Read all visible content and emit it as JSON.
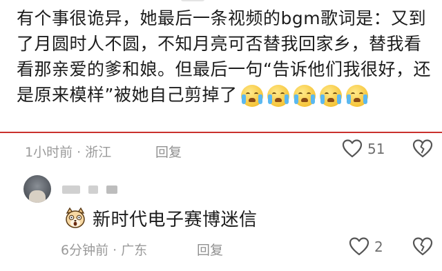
{
  "comment": {
    "text": "有个事很诡异，她最后一条视频的bgm歌词是：又到了月圆时人不圆，不知月亮可否替我回家乡，替我看看那亲爱的爹和娘。但最后一句“告诉他们我很好，还是原来模样”被她自己剪掉了",
    "emoji_count": 5,
    "emoji_name": "crying-emoji",
    "time": "1小时前 · 浙江",
    "reply_label": "回复",
    "likes": "51"
  },
  "reply": {
    "text": "新时代电子赛博迷信",
    "emoji_name": "shocked-dog-emoji",
    "time": "6分钟前 · 广东",
    "reply_label": "回复",
    "likes": "2"
  },
  "colors": {
    "divider": "#c9302c",
    "meta_text": "#9a9a9a",
    "body_text": "#1c1c1c"
  }
}
